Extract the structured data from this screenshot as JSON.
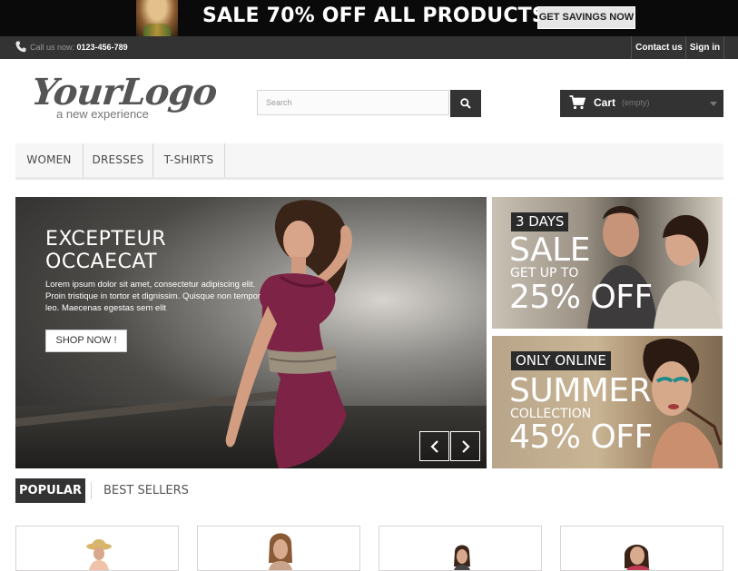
{
  "promo_banner": {
    "text": "SALE 70% OFF ALL PRODUCTS",
    "button_label": "GET SAVINGS NOW"
  },
  "topbar": {
    "call_label": "Call us now: ",
    "phone": "0123-456-789",
    "links": [
      "Contact us",
      "Sign in"
    ]
  },
  "header": {
    "logo_main": "YourLogo",
    "logo_tagline": "a new experience",
    "search_placeholder": "Search",
    "cart_label": "Cart",
    "cart_status": "(empty)"
  },
  "menu": {
    "items": [
      "WOMEN",
      "DRESSES",
      "T-SHIRTS"
    ]
  },
  "hero": {
    "title_line1": "EXCEPTEUR",
    "title_line2": "OCCAECAT",
    "text": "Lorem ipsum dolor sit amet, consectetur adipiscing elit. Proin tristique in tortor et dignissim. Quisque non tempor leo. Maecenas egestas sem elit",
    "button_label": "SHOP NOW !"
  },
  "tiles": [
    {
      "tag": "3 DAYS",
      "line1": "SALE",
      "line2": "GET UP TO",
      "line3": "25% OFF"
    },
    {
      "tag": "ONLY ONLINE",
      "line1": "SUMMER",
      "line2": "COLLECTION",
      "line3": "45% OFF"
    }
  ],
  "tabs": {
    "popular": "POPULAR",
    "best_sellers": "BEST SELLERS"
  },
  "colors": {
    "dark": "#333333",
    "banner": "#0a0a0a",
    "menu_bg": "#f6f6f6",
    "dress": "#7d2346"
  },
  "icons": [
    "phone-icon",
    "search-icon",
    "cart-icon",
    "chevron-left-icon",
    "chevron-right-icon"
  ]
}
